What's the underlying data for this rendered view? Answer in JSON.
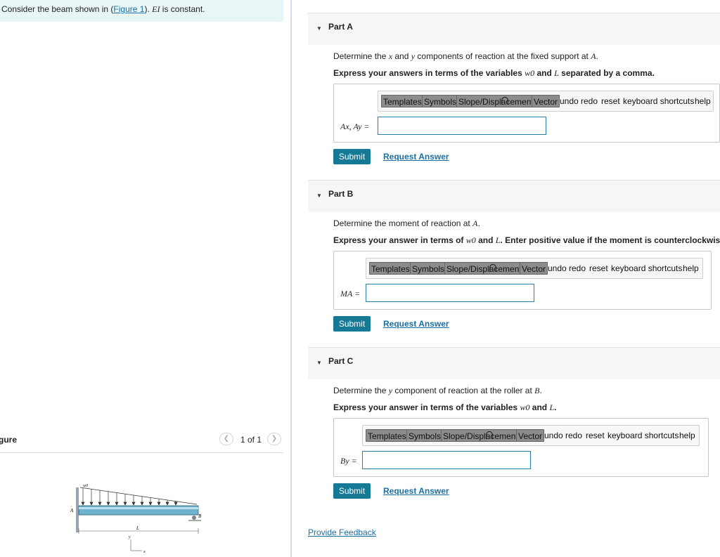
{
  "intro": {
    "before": "Consider the beam shown in (",
    "link": "Figure 1",
    "after": "). ",
    "math": "EI",
    "after2": " is constant."
  },
  "figure": {
    "label": "gure",
    "count": "1 of 1",
    "prev_icon": "chevron-left-icon",
    "next_icon": "chevron-right-icon",
    "labels": {
      "load": "w0",
      "a": "A",
      "b": "B",
      "length": "L",
      "y": "y",
      "x": "x"
    }
  },
  "toolbar": {
    "templates": "Templates",
    "symbols": "Symbols",
    "slope": "Slope/Displacement",
    "vector": "Vector",
    "undo": "undo",
    "redo": "redo",
    "reset": "reset",
    "shortcuts": "keyboard shortcuts",
    "help": "help"
  },
  "parts": [
    {
      "title": "Part A",
      "prompt_pre": "Determine the ",
      "prompt_m1": "x",
      "prompt_mid": " and ",
      "prompt_m2": "y",
      "prompt_mid2": " components of reaction at the fixed support at ",
      "prompt_m3": "A",
      "prompt_end": ".",
      "instr_pre": "Express your answers in terms of the variables ",
      "instr_m1": "w0",
      "instr_mid": " and ",
      "instr_m2": "L",
      "instr_end": " separated by a comma.",
      "var_label": "Ax, Ay =",
      "submit": "Submit",
      "request": "Request Answer"
    },
    {
      "title": "Part B",
      "prompt_pre": "Determine the moment of reaction at ",
      "prompt_m1": "A",
      "prompt_end": ".",
      "instr_pre": "Express your answer in terms of ",
      "instr_m1": "w0",
      "instr_mid": " and ",
      "instr_m2": "L",
      "instr_end": ". Enter positive value if the moment is counterclockwise ar",
      "var_label": "MA =",
      "submit": "Submit",
      "request": "Request Answer"
    },
    {
      "title": "Part C",
      "prompt_pre": "Determine the ",
      "prompt_m1": "y",
      "prompt_mid": " component of reaction at the roller at ",
      "prompt_m2": "B",
      "prompt_end": ".",
      "instr_pre": "Express your answer in terms of the variables ",
      "instr_m1": "w0",
      "instr_mid": " and ",
      "instr_m2": "L",
      "instr_end": ".",
      "var_label": "By =",
      "submit": "Submit",
      "request": "Request Answer"
    }
  ],
  "feedback": "Provide Feedback"
}
